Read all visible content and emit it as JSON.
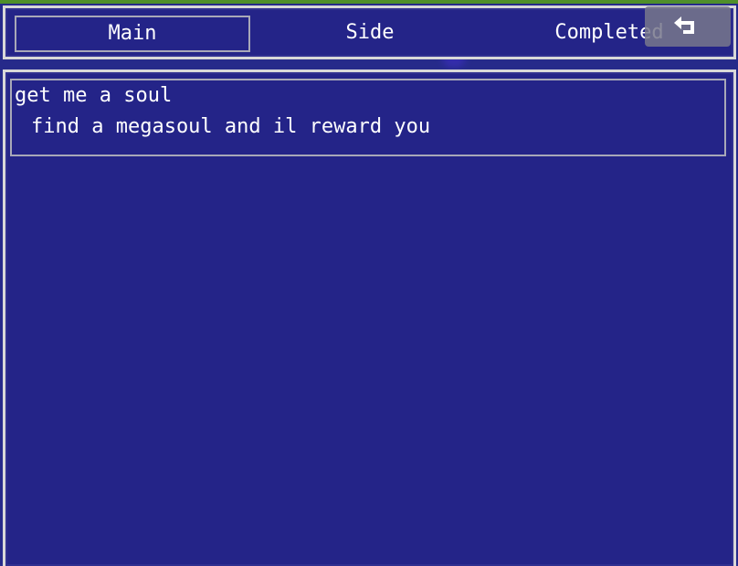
{
  "tabs": [
    {
      "label": "Main",
      "selected": true
    },
    {
      "label": "Side",
      "selected": false
    },
    {
      "label": "Completed",
      "selected": false
    }
  ],
  "back_button": {
    "icon": "back-arrow-icon"
  },
  "quests": [
    {
      "title": "get me a soul",
      "description": "find a megasoul and il reward you"
    }
  ],
  "colors": {
    "window_bg": "#242488",
    "window_border": "#d8d8d8",
    "selection_border": "#a8a8b8",
    "text": "#ffffff",
    "top_strip": "#4f8f2a"
  }
}
